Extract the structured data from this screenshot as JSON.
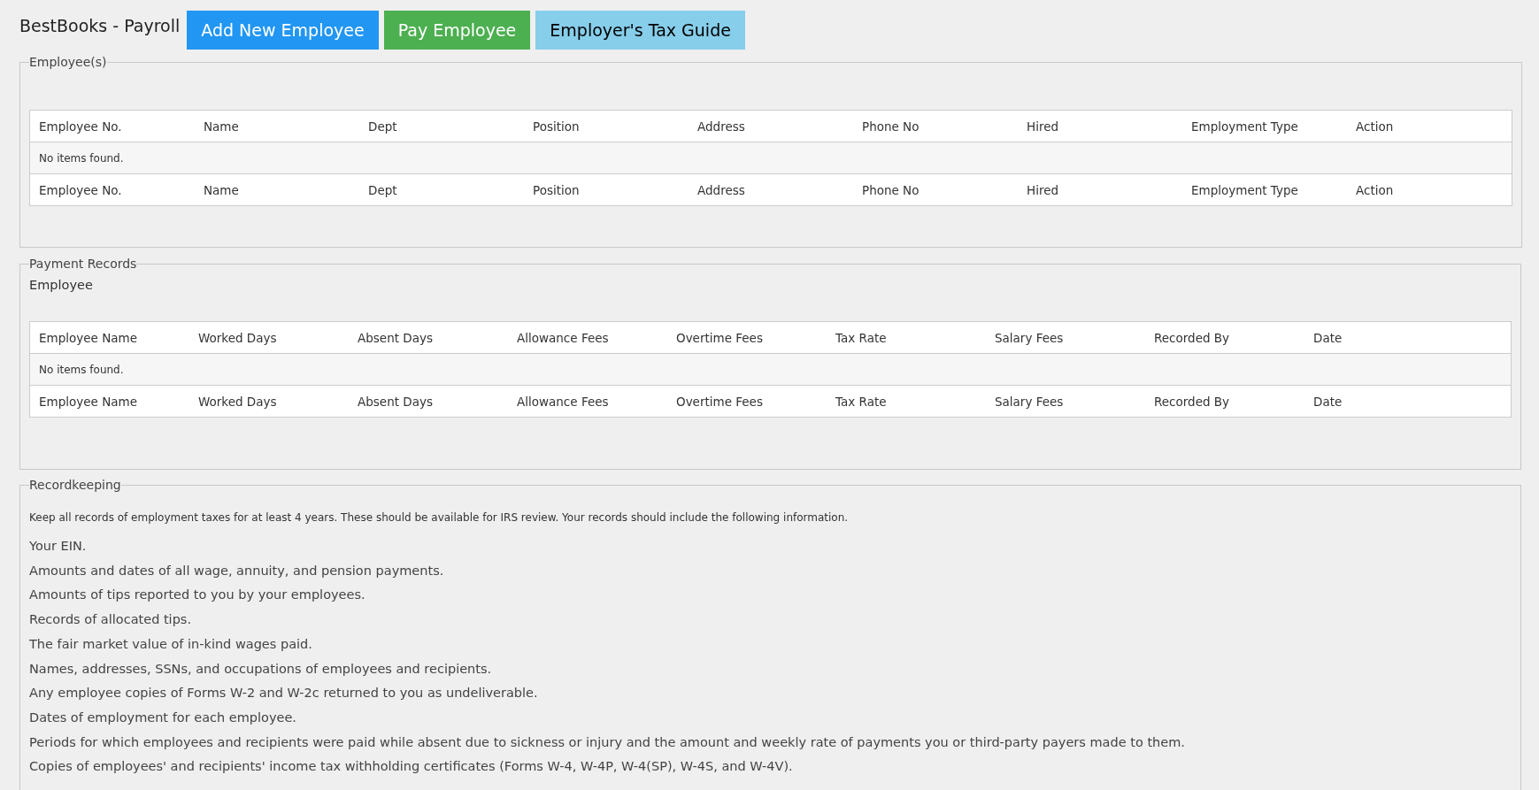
{
  "app_title": "BestBooks - Payroll",
  "buttons": [
    {
      "label": "Add New Employee",
      "kind": "primary"
    },
    {
      "label": "Pay Employee",
      "kind": "success"
    },
    {
      "label": "Employer's Tax Guide",
      "kind": "info"
    }
  ],
  "employees": {
    "legend": "Employee(s)",
    "columns": [
      "Employee No.",
      "Name",
      "Dept",
      "Position",
      "Address",
      "Phone No",
      "Hired",
      "Employment Type",
      "Action"
    ],
    "empty_text": "No items found.",
    "footer_columns": [
      "Employee No.",
      "Name",
      "Dept",
      "Position",
      "Address",
      "Phone No",
      "Hired",
      "Employment Type",
      "Action"
    ]
  },
  "payment_records": {
    "legend": "Payment Records",
    "label": "Employee",
    "columns": [
      "Employee Name",
      "Worked Days",
      "Absent Days",
      "Allowance Fees",
      "Overtime Fees",
      "Tax Rate",
      "Salary Fees",
      "Recorded By",
      "Date"
    ],
    "empty_text": "No items found.",
    "footer_columns": [
      "Employee Name",
      "Worked Days",
      "Absent Days",
      "Allowance Fees",
      "Overtime Fees",
      "Tax Rate",
      "Salary Fees",
      "Recorded By",
      "Date"
    ]
  },
  "recordkeeping": {
    "legend": "Recordkeeping",
    "intro": "Keep all records of employment taxes for at least 4 years. These should be available for IRS review. Your records should include the following information.",
    "items": [
      "Your EIN.",
      "Amounts and dates of all wage, annuity, and pension payments.",
      "Amounts of tips reported to you by your employees.",
      "Records of allocated tips.",
      "The fair market value of in-kind wages paid.",
      "Names, addresses, SSNs, and occupations of employees and recipients.",
      "Any employee copies of Forms W-2 and W-2c returned to you as undeliverable.",
      "Dates of employment for each employee.",
      "Periods for which employees and recipients were paid while absent due to sickness or injury and the amount and weekly rate of payments you or third-party payers made to them.",
      "Copies of employees' and recipients' income tax withholding certificates (Forms W-4, W-4P, W-4(SP), W-4S, and W-4V)."
    ]
  }
}
